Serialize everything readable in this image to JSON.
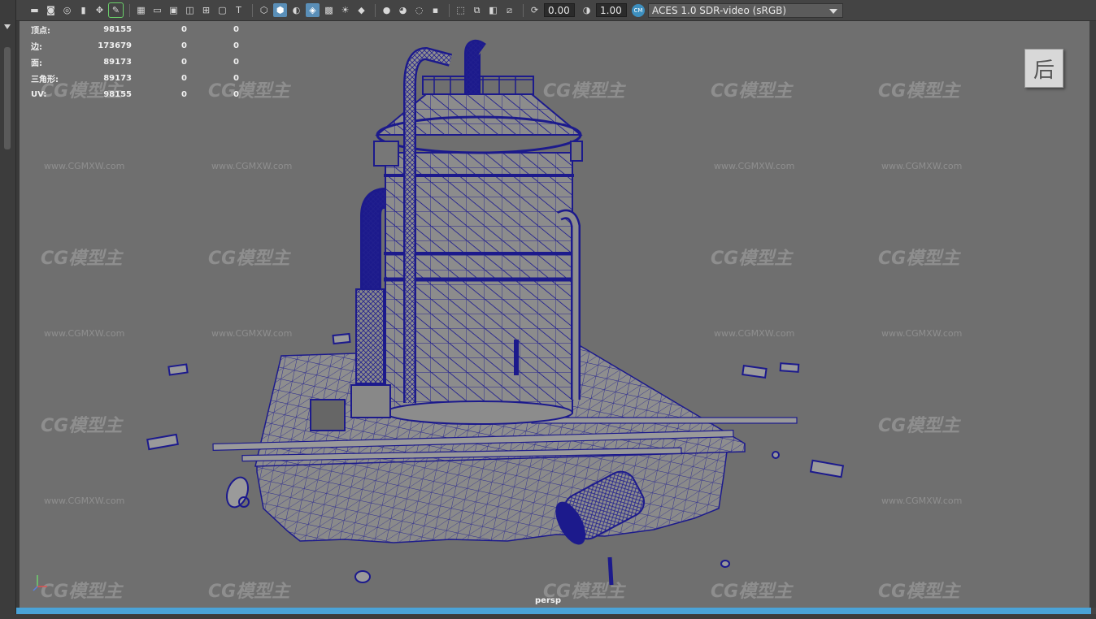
{
  "toolbar": {
    "exposure_value": "0.00",
    "gamma_value": "1.00",
    "colorspace_badge": "CM",
    "colorspace_label": "ACES 1.0 SDR-video (sRGB)",
    "icons": [
      "camera-icon",
      "camera-lock-icon",
      "camera-move-icon",
      "bookmark-icon",
      "snap-icon",
      "pencil-icon",
      "grid-icon",
      "film-gate-icon",
      "resolution-gate-icon",
      "gate-mask-icon",
      "field-chart-icon",
      "safe-action-icon",
      "safe-title-icon",
      "wireframe-icon",
      "smooth-shade-icon",
      "shaded-wireframe-icon",
      "default-material-icon",
      "xray-icon",
      "light-icon",
      "shadow-icon",
      "ambient-occlusion-icon",
      "motion-blur-icon",
      "anti-alias-icon",
      "depth-of-field-icon",
      "isolate-select-icon",
      "xray-joints-icon",
      "xray-components-icon",
      "texture-icon",
      "backface-icon",
      "exposure-icon",
      "gamma-icon"
    ]
  },
  "stats": {
    "rows": [
      {
        "label": "顶点:",
        "v1": "98155",
        "v2": "0",
        "v3": "0"
      },
      {
        "label": "边:",
        "v1": "173679",
        "v2": "0",
        "v3": "0"
      },
      {
        "label": "面:",
        "v1": "89173",
        "v2": "0",
        "v3": "0"
      },
      {
        "label": "三角形:",
        "v1": "89173",
        "v2": "0",
        "v3": "0"
      },
      {
        "label": "UV:",
        "v1": "98155",
        "v2": "0",
        "v3": "0"
      }
    ]
  },
  "view_cube": {
    "label": "后"
  },
  "camera": {
    "name": "persp"
  },
  "watermark": {
    "logo": "CG模型主",
    "url": "www.CGMXW.com"
  },
  "colors": {
    "wire": "#1c1a8c",
    "surface": "#8c8c8c",
    "background": "#6f6f6f",
    "accent": "#4aa3d8"
  }
}
